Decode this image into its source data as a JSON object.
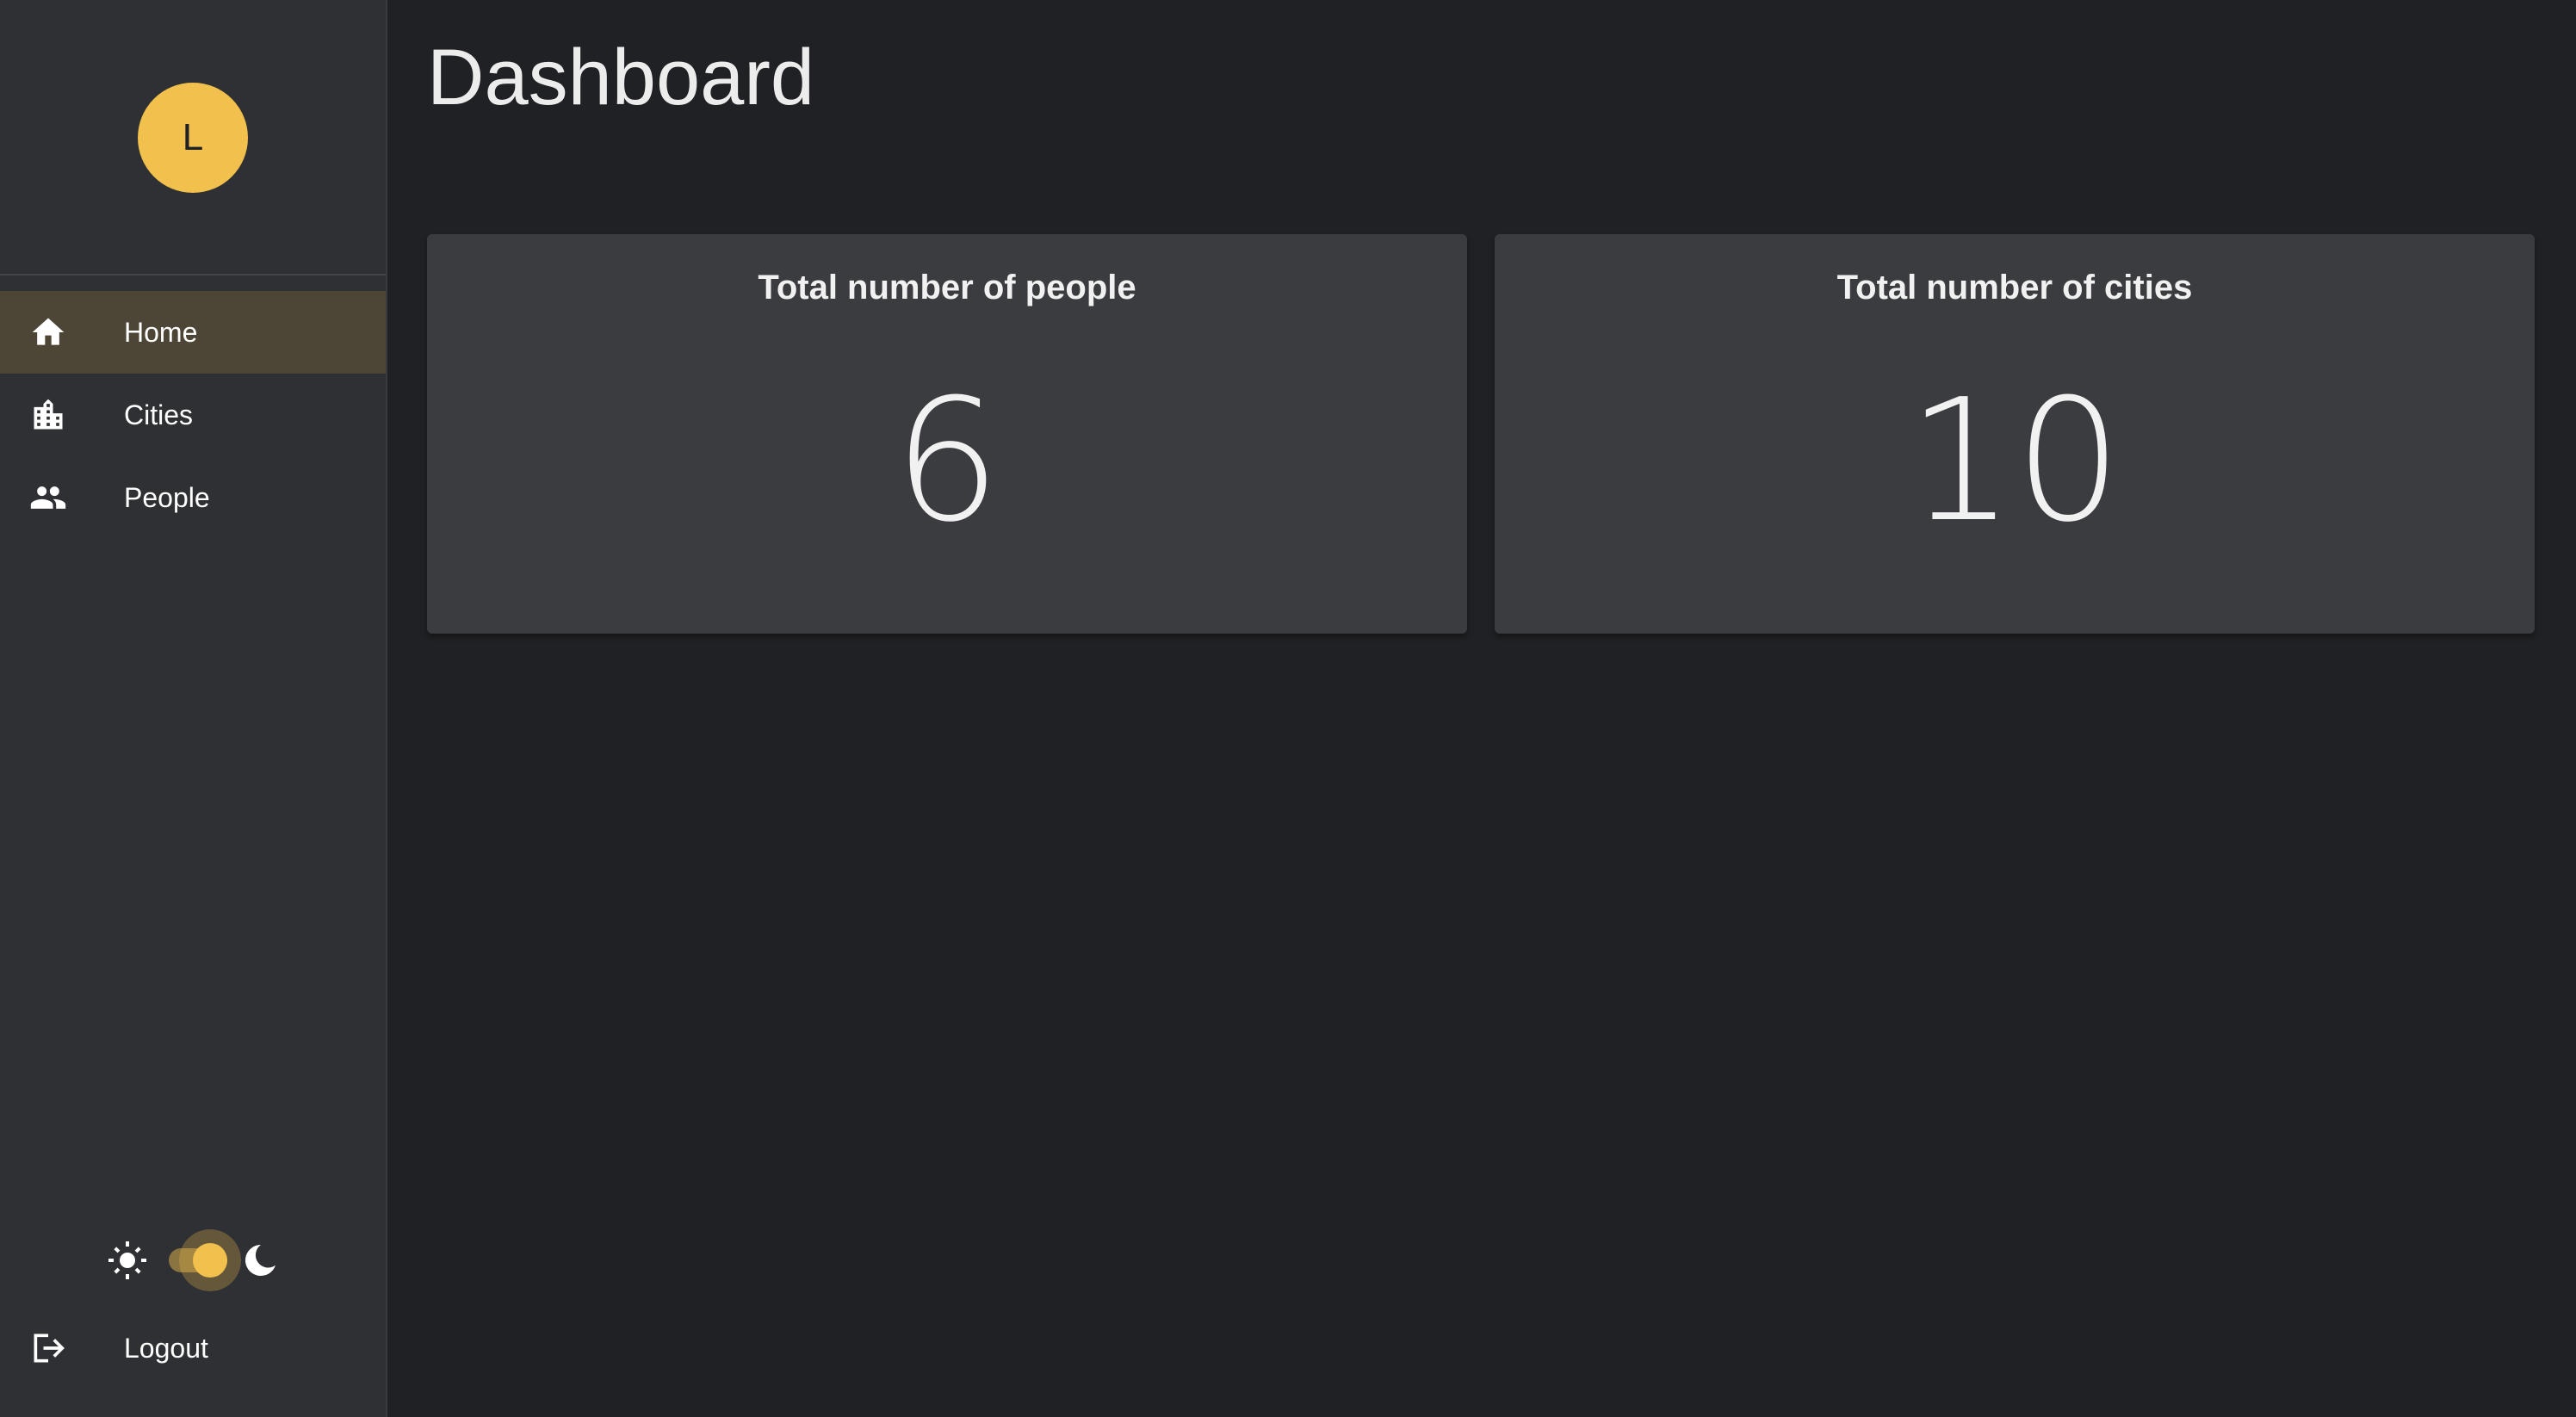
{
  "user": {
    "avatar_initial": "L"
  },
  "sidebar": {
    "items": [
      {
        "label": "Home",
        "icon": "home-icon",
        "active": true
      },
      {
        "label": "Cities",
        "icon": "city-icon",
        "active": false
      },
      {
        "label": "People",
        "icon": "people-icon",
        "active": false
      }
    ],
    "theme_toggle": {
      "mode": "dark",
      "left_icon": "sun-icon",
      "right_icon": "moon-icon"
    },
    "logout_label": "Logout"
  },
  "main": {
    "title": "Dashboard",
    "cards": [
      {
        "title": "Total number of people",
        "value": "6"
      },
      {
        "title": "Total number of cities",
        "value": "10"
      }
    ]
  },
  "colors": {
    "accent": "#f1c04d",
    "background": "#202124",
    "sidebar": "#2f3034",
    "card": "#3b3c40",
    "active_item": "#4d4636"
  }
}
